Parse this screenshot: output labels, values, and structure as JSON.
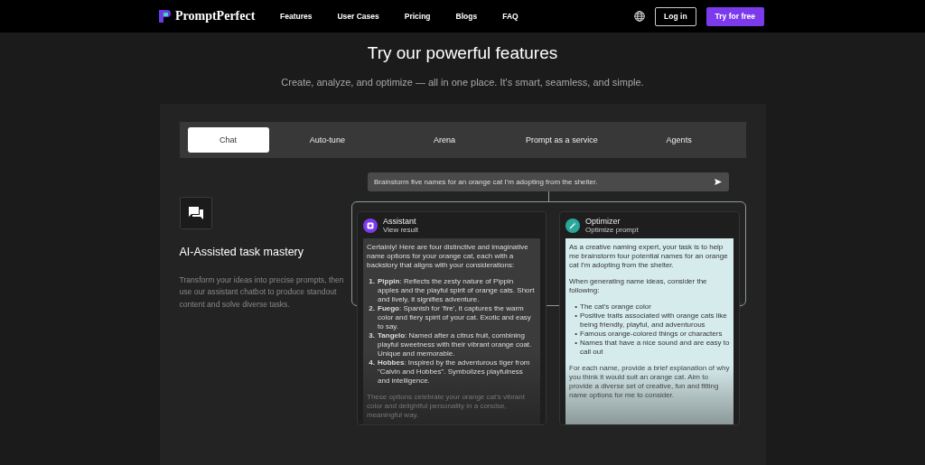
{
  "nav": {
    "brand": "PromptPerfect",
    "links": [
      "Features",
      "User Cases",
      "Pricing",
      "Blogs",
      "FAQ"
    ],
    "login": "Log in",
    "cta": "Try for free"
  },
  "hero": {
    "title": "Try our powerful features",
    "subtitle": "Create, analyze, and optimize — all in one place. It's smart, seamless, and simple."
  },
  "tabs": [
    {
      "label": "Chat",
      "selected": true
    },
    {
      "label": "Auto-tune",
      "selected": false
    },
    {
      "label": "Arena",
      "selected": false
    },
    {
      "label": "Prompt as a service",
      "selected": false
    },
    {
      "label": "Agents",
      "selected": false
    }
  ],
  "feature": {
    "title": "AI-Assisted task mastery",
    "description": "Transform your ideas into precise prompts, then use our assistant chatbot to produce standout content and solve diverse tasks."
  },
  "prompt": {
    "value": "Brainstorm five names for an orange cat I'm adopting from the shelter."
  },
  "cards": [
    {
      "kind": "assistant",
      "title": "Assistant",
      "subtitle": "View result",
      "intro": "Certainly! Here are four distinctive and imaginative name options for your orange cat, each with a backstory that aligns with your considerations:",
      "items": [
        {
          "marker": "1.",
          "text": "**Pippin**: Reflects the zesty nature of Pippin apples and the playful spirit of orange cats. Short and lively, it signifies adventure."
        },
        {
          "marker": "2.",
          "text": "**Fuego**: Spanish for 'fire', it captures the warm color and fiery spirit of your cat. Exotic and easy to say."
        },
        {
          "marker": "3.",
          "text": "**Tangelo**: Named after a citrus fruit, combining playful sweetness with their vibrant orange coat. Unique and memorable."
        },
        {
          "marker": "4.",
          "text": "**Hobbes**: Inspired by the adventurous tiger from \"Calvin and Hobbes\". Symbolizes playfulness and intelligence."
        }
      ],
      "outro": "These options celebrate your orange cat's vibrant color and delightful personality in a concise, meaningful way."
    },
    {
      "kind": "optimizer",
      "title": "Optimizer",
      "subtitle": "Optimize prompt",
      "intro": "As a creative naming expert, your task is to help me brainstorm four potential names for an orange cat I'm adopting from the shelter.",
      "lead": "When generating name ideas, consider the following:",
      "items": [
        {
          "marker": "•",
          "text": "The cat's orange color"
        },
        {
          "marker": "•",
          "text": "Positive traits associated with orange cats like being friendly, playful, and adventurous"
        },
        {
          "marker": "•",
          "text": "Famous orange-colored things or characters"
        },
        {
          "marker": "•",
          "text": "Names that have a nice sound and are easy to call out"
        }
      ],
      "outro": "For each name, provide a brief explanation of why you think it would suit an orange cat. Aim to provide a diverse set of creative, fun and fitting name options for me to consider."
    }
  ]
}
